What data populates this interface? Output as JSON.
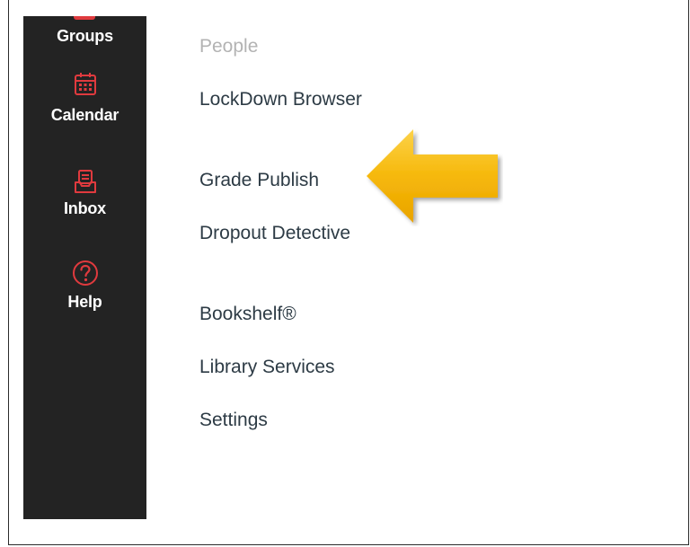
{
  "global_nav": {
    "items": [
      {
        "label": "Groups",
        "icon": "groups-icon"
      },
      {
        "label": "Calendar",
        "icon": "calendar-icon"
      },
      {
        "label": "Inbox",
        "icon": "inbox-icon"
      },
      {
        "label": "Help",
        "icon": "help-icon"
      }
    ],
    "icon_color": "#e03a3e",
    "background": "#232323"
  },
  "course_nav": {
    "items": [
      {
        "label": "People",
        "state": "disabled"
      },
      {
        "label": "LockDown Browser"
      },
      {
        "label": "Grade Publish"
      },
      {
        "label": "Dropout Detective"
      },
      {
        "label": "Bookshelf®"
      },
      {
        "label": "Library Services"
      },
      {
        "label": "Settings"
      }
    ]
  },
  "annotation": {
    "arrow_color": "#f6b80a",
    "points_to": "Grade Publish"
  }
}
